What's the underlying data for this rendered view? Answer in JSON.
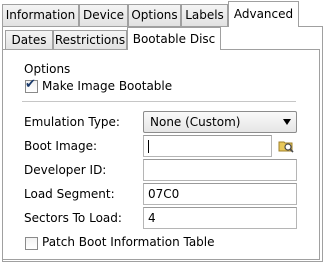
{
  "top_tabs": [
    {
      "label": "Information",
      "active": false
    },
    {
      "label": "Device",
      "active": false
    },
    {
      "label": "Options",
      "active": false
    },
    {
      "label": "Labels",
      "active": false
    },
    {
      "label": "Advanced",
      "active": true
    }
  ],
  "sub_tabs": [
    {
      "label": "Dates",
      "active": false
    },
    {
      "label": "Restrictions",
      "active": false
    },
    {
      "label": "Bootable Disc",
      "active": true
    }
  ],
  "options": {
    "heading": "Options",
    "make_bootable": {
      "label": "Make Image Bootable",
      "checked": true
    }
  },
  "fields": {
    "emulation_type": {
      "label": "Emulation Type:",
      "value": "None (Custom)"
    },
    "boot_image": {
      "label": "Boot Image:",
      "value": ""
    },
    "developer_id": {
      "label": "Developer ID:",
      "value": ""
    },
    "load_segment": {
      "label": "Load Segment:",
      "value": "07C0"
    },
    "sectors_to_load": {
      "label": "Sectors To Load:",
      "value": "4"
    }
  },
  "patch_boot_table": {
    "label": "Patch Boot Information Table",
    "checked": false
  },
  "icons": {
    "browse": "browse-folder-icon",
    "dropdown": "chevron-down-icon"
  }
}
